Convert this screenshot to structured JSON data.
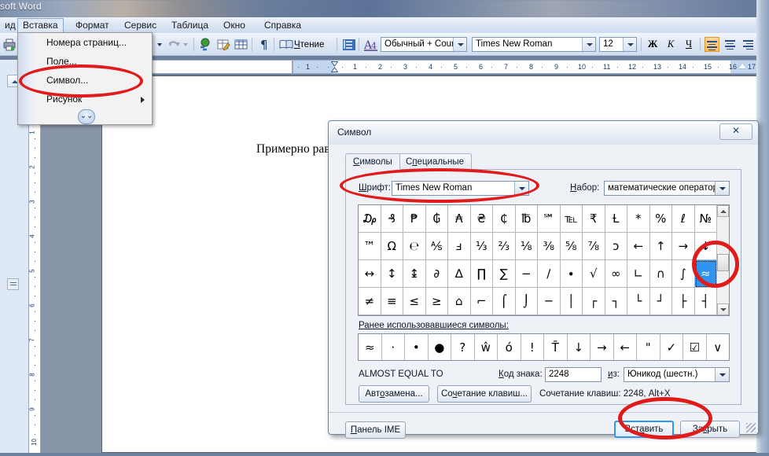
{
  "window": {
    "title": "soft Word"
  },
  "menubar": {
    "items": [
      {
        "label": "ид",
        "active": false
      },
      {
        "label": "Вставка",
        "active": true
      },
      {
        "label": "Формат",
        "active": false
      },
      {
        "label": "Сервис",
        "active": false
      },
      {
        "label": "Таблица",
        "active": false
      },
      {
        "label": "Окно",
        "active": false
      },
      {
        "label": "Справка",
        "active": false
      }
    ]
  },
  "insert_menu": {
    "items": [
      {
        "label": "Номера страниц...",
        "submenu": false
      },
      {
        "label": "Поле...",
        "submenu": false
      },
      {
        "label": "Символ...",
        "submenu": false
      },
      {
        "label": "Рисунок",
        "submenu": true
      }
    ],
    "expander_icon": "chevron-double-down-icon"
  },
  "toolbar": {
    "reading_label": "Чтение",
    "style_value": "Обычный + Couri",
    "font_value": "Times New Roman",
    "size_value": "12",
    "bold_label": "Ж",
    "italic_label": "К",
    "underline_label": "Ч",
    "icons": [
      "print-icon",
      "undo-icon",
      "redo-icon",
      "hyperlink-icon",
      "tables-borders-icon",
      "insert-table-icon",
      "show-formatting-icon",
      "reading-layout-icon",
      "line-spacing-icon",
      "styles-icon"
    ]
  },
  "ruler": {
    "h_ticks": [
      "1",
      "1",
      "2",
      "3",
      "4",
      "5",
      "6",
      "7",
      "8",
      "9",
      "10",
      "11",
      "12",
      "13",
      "14",
      "15",
      "16",
      "17"
    ],
    "v_ticks": [
      "1",
      "2",
      "3",
      "4",
      "5",
      "6",
      "7",
      "8",
      "9",
      "10"
    ]
  },
  "document": {
    "text": "Примерно равно ≈"
  },
  "dialog": {
    "title": "Символ",
    "close_label": "✕",
    "tabs": [
      {
        "label": "Символы",
        "selected": true
      },
      {
        "label": "Специальные знаки",
        "selected": false
      }
    ],
    "font_label": "Шрифт:",
    "font_value": "Times New Roman",
    "subset_label": "Набор:",
    "subset_value": "математические операторы",
    "grid_rows": [
      [
        "₯",
        "₰",
        "₱",
        "₲",
        "₳",
        "₴",
        "₵",
        "℔",
        "℠",
        "℡",
        "₹",
        "Ƚ",
        "*",
        "%",
        "ℓ",
        "№"
      ],
      [
        "™",
        "Ω",
        "℮",
        "⅍",
        "ⅎ",
        "⅓",
        "⅔",
        "⅛",
        "⅜",
        "⅝",
        "⅞",
        "ↄ",
        "←",
        "↑",
        "→",
        "↓"
      ],
      [
        "↔",
        "↕",
        "↨",
        "∂",
        "∆",
        "∏",
        "∑",
        "−",
        "∕",
        "∙",
        "√",
        "∞",
        "∟",
        "∩",
        "∫",
        "≈"
      ],
      [
        "≠",
        "≡",
        "≤",
        "≥",
        "⌂",
        "⌐",
        "⌠",
        "⌡",
        "─",
        "│",
        "┌",
        "┐",
        "└",
        "┘",
        "├",
        "┤"
      ]
    ],
    "selected_cell": {
      "row": 2,
      "col": 15
    },
    "recent_label": "Ранее использовавшиеся символы:",
    "recent_symbols": [
      "≈",
      "·",
      "•",
      "●",
      "?",
      "ŵ",
      "ó",
      "!",
      "T̄",
      "↓",
      "→",
      "←",
      "\"",
      "✓",
      "☑",
      "∨"
    ],
    "char_name": "ALMOST EQUAL TO",
    "charcode_label": "Код знака:",
    "charcode_value": "2248",
    "from_label": "из:",
    "from_value": "Юникод (шестн.)",
    "autocorrect_button": "Автозамена...",
    "shortcut_button": "Сочетание клавиш...",
    "shortcut_text": "Сочетание клавиш: 2248, Alt+X",
    "ime_button": "Панель IME",
    "insert_button": "Вставить",
    "close_button": "Закрыть"
  },
  "colors": {
    "accent": "#2f95f0",
    "marker": "#e01b1b",
    "dialog_bg": "#eef1f6",
    "workspace": "#8894a8"
  }
}
